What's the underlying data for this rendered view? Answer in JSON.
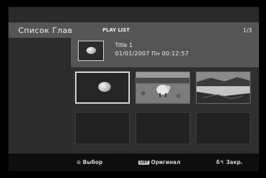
{
  "header": {
    "title": "Список Глав",
    "subtitle": "PLAY LIST",
    "page": "1/3"
  },
  "selected": {
    "title": "Title 1",
    "date_time": "01/01/2007  Пн  00:12:57"
  },
  "thumbnails": [
    {
      "icon": "ball-thumbnail-icon",
      "active": true
    },
    {
      "icon": "sheep-field-thumbnail-icon",
      "active": false
    },
    {
      "icon": "river-landscape-thumbnail-icon",
      "active": false
    },
    {
      "icon": "empty",
      "active": false
    },
    {
      "icon": "empty",
      "active": false
    },
    {
      "icon": "empty",
      "active": false
    }
  ],
  "footer": {
    "select_icon": "⊙",
    "select_label": "Выбор",
    "list_badge": "LIST",
    "list_label": "Оригинал",
    "close_icon": "δ↰",
    "close_label": "Закр."
  },
  "colors": {
    "screen_bg": "#2a2a2a",
    "band": "#555555",
    "footer_bg": "#0e0e0e",
    "highlight": "#d8d8d8"
  }
}
